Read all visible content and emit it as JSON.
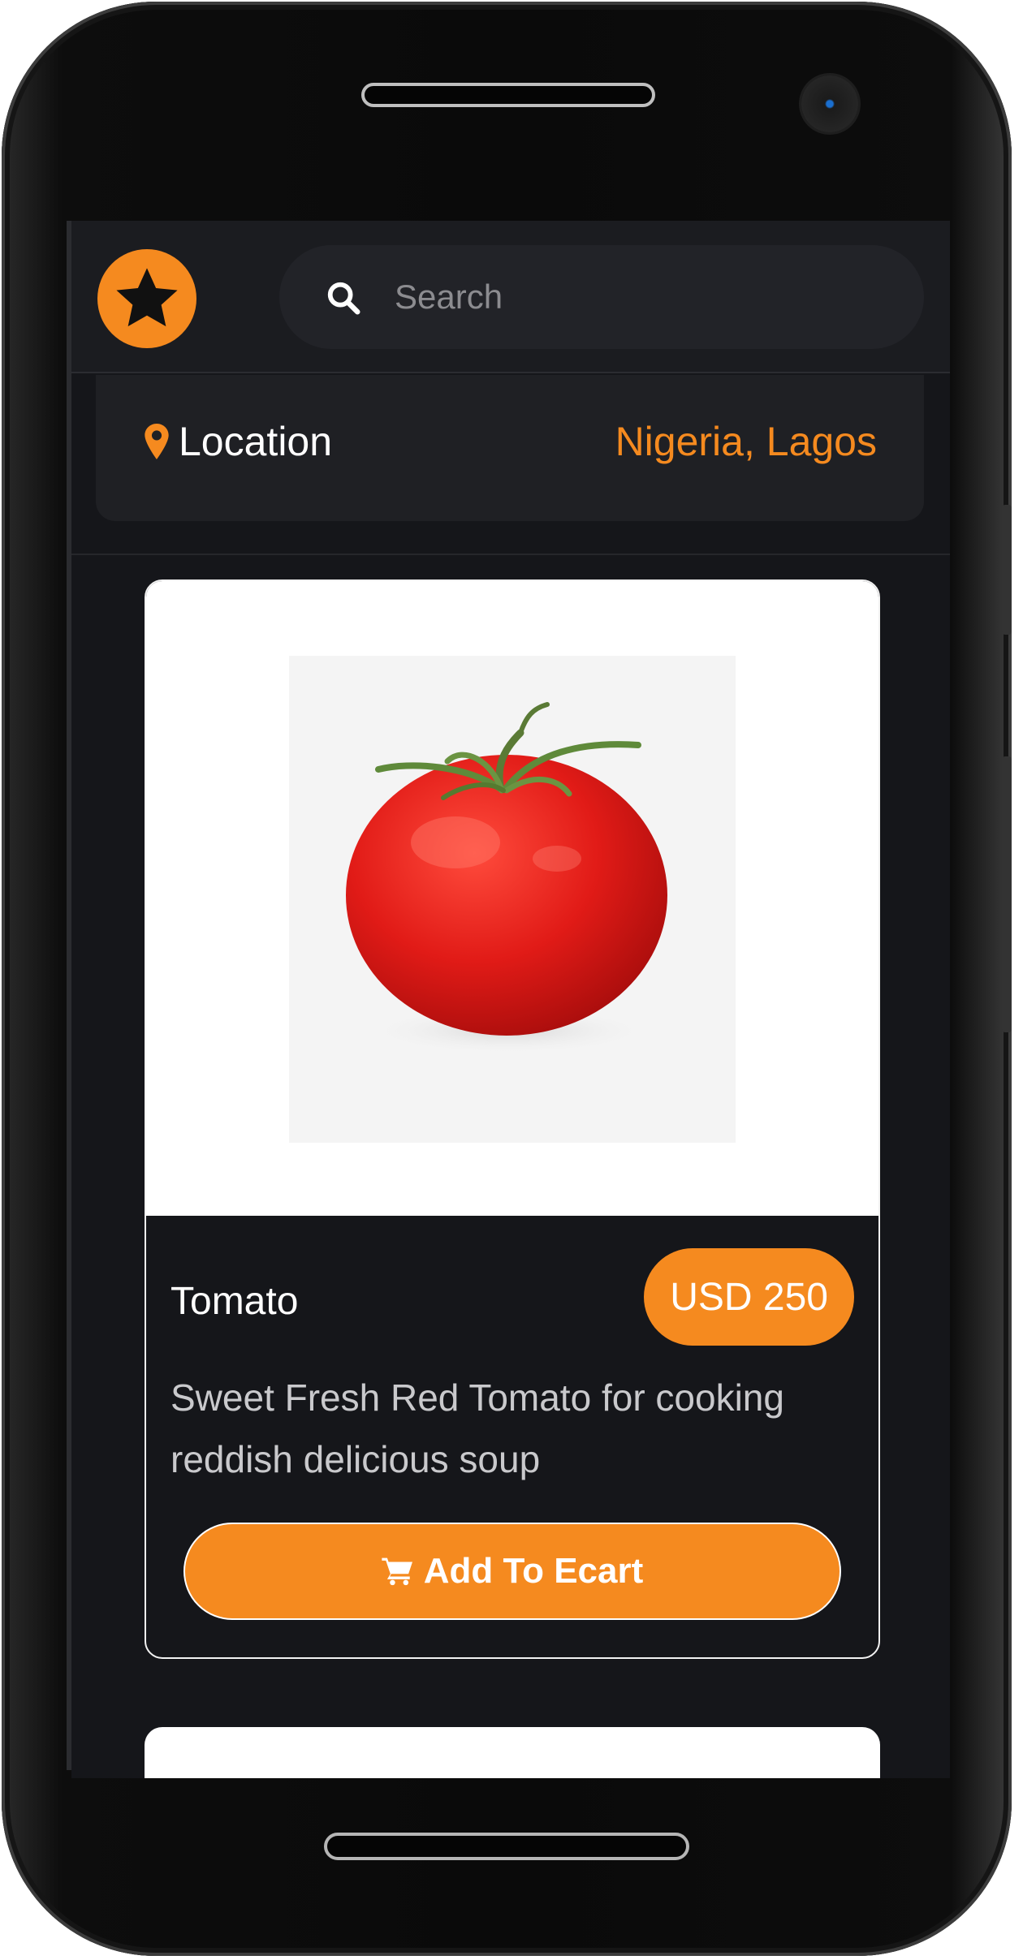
{
  "search": {
    "placeholder": "Search"
  },
  "location": {
    "label": "Location",
    "value": "Nigeria, Lagos"
  },
  "product": {
    "name": "Tomato",
    "price": "USD 250",
    "description": "Sweet Fresh Red Tomato for cooking reddish delicious soup",
    "add_button_label": "Add To Ecart"
  },
  "icons": {
    "logo": "star-icon",
    "search": "search-icon",
    "location": "map-pin-icon",
    "cart": "cart-icon"
  },
  "colors": {
    "accent": "#f58a1f",
    "background": "#15161a",
    "header": "#1b1c20",
    "text": "#ffffff"
  }
}
